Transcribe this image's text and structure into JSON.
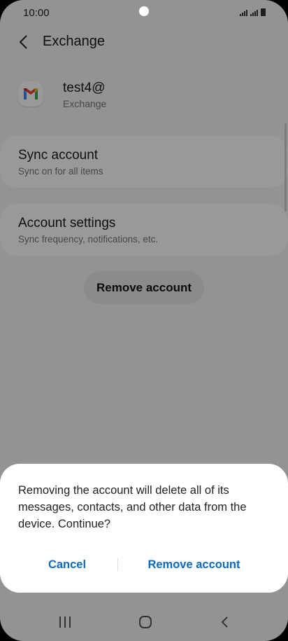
{
  "status": {
    "time": "10:00"
  },
  "appbar": {
    "title": "Exchange",
    "back_icon": "chevron-left-icon"
  },
  "account": {
    "name": "test4@",
    "type": "Exchange",
    "icon": "gmail-icon"
  },
  "items": [
    {
      "title": "Sync account",
      "subtitle": "Sync on for all items"
    },
    {
      "title": "Account settings",
      "subtitle": "Sync frequency, notifications, etc."
    }
  ],
  "remove_button": {
    "label": "Remove account"
  },
  "dialog": {
    "message": "Removing the account will delete all of its messages, contacts, and other data from the device. Continue?",
    "cancel_label": "Cancel",
    "confirm_label": "Remove account",
    "accent_color": "#0a6bbd"
  },
  "navbar": {
    "recents": "recents-icon",
    "home": "home-icon",
    "back": "back-icon"
  }
}
